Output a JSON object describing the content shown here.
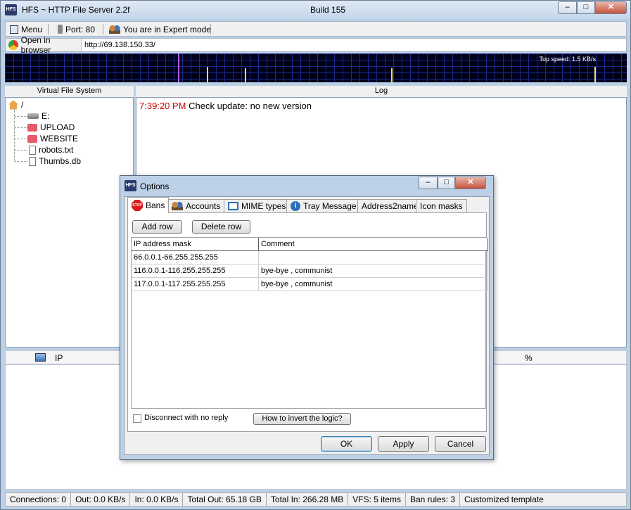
{
  "window": {
    "title": "HFS ~ HTTP File Server 2.2f",
    "build": "Build 155",
    "app_icon": "HFS"
  },
  "toolbar": {
    "menu_label": "Menu",
    "port_label": "Port: 80",
    "mode_label": "You are in Expert mode"
  },
  "urlbar": {
    "open_label": "Open in browser",
    "url": "http://69.138.150.33/"
  },
  "graph": {
    "top_speed": "Top speed: 1.5 KB/s"
  },
  "vfs": {
    "header": "Virtual File System",
    "root": "/",
    "items": [
      {
        "label": "E:",
        "icon": "drive-icon"
      },
      {
        "label": "UPLOAD",
        "icon": "folder-icon"
      },
      {
        "label": "WEBSITE",
        "icon": "folder-icon"
      },
      {
        "label": "robots.txt",
        "icon": "file-icon"
      },
      {
        "label": "Thumbs.db",
        "icon": "file-icon"
      }
    ]
  },
  "log": {
    "header": "Log",
    "time": "7:39:20 PM",
    "message": "Check update: no new version"
  },
  "connections": {
    "ip_header": "IP",
    "percent_header": "%"
  },
  "statusbar": [
    "Connections: 0",
    "Out: 0.0 KB/s",
    "In: 0.0 KB/s",
    "Total Out: 65.18 GB",
    "Total In: 266.28 MB",
    "VFS: 5 items",
    "Ban rules: 3",
    "Customized template"
  ],
  "options": {
    "title": "Options",
    "tabs": [
      "Bans",
      "Accounts",
      "MIME types",
      "Tray Message",
      "Address2name",
      "Icon masks"
    ],
    "add_row": "Add row",
    "delete_row": "Delete row",
    "columns": [
      "IP address mask",
      "Comment"
    ],
    "rows": [
      [
        "66.0.0.1-66.255.255.255",
        ""
      ],
      [
        "116.0.0.1-116.255.255.255",
        "bye-bye , communist"
      ],
      [
        "117.0.0.1-117.255.255.255",
        "bye-bye , communist"
      ]
    ],
    "disconnect_label": "Disconnect with no reply",
    "invert_label": "How to invert the logic?",
    "ok": "OK",
    "apply": "Apply",
    "cancel": "Cancel",
    "stop_icon_text": "STOP"
  },
  "window_controls": {
    "minimize": "–",
    "maximize": "□",
    "close": "✕"
  }
}
